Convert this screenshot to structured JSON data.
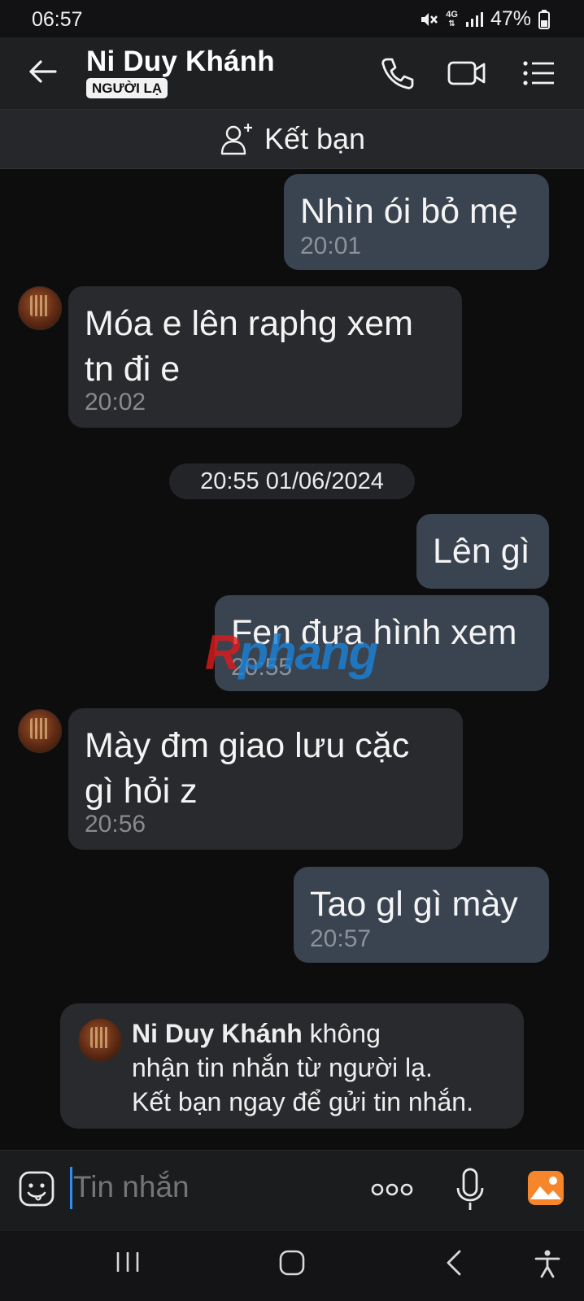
{
  "status_bar": {
    "time": "06:57",
    "network": "4G",
    "battery": "47%",
    "icons": [
      "mute-icon",
      "signal-icon",
      "battery-icon"
    ]
  },
  "header": {
    "contact_name": "Ni Duy Khánh",
    "badge": "NGƯỜI LẠ",
    "icons": [
      "back-arrow-icon",
      "phone-icon",
      "video-call-icon",
      "menu-list-icon"
    ]
  },
  "friend_bar": {
    "label": "Kết bạn",
    "icon": "add-person-icon"
  },
  "messages": [
    {
      "direction": "out",
      "text": "Nhìn ói bỏ mẹ",
      "time": "20:01"
    },
    {
      "direction": "in",
      "text": "Móa e lên raphg xem\ntn đi e",
      "time": "20:02"
    },
    {
      "direction": "out",
      "text": "Lên gì",
      "time": ""
    },
    {
      "direction": "out",
      "text": "Fen đưa hình xem",
      "time": "20:55"
    },
    {
      "direction": "in",
      "text": "Mày đm giao lưu cặc\ngì hỏi z",
      "time": "20:56"
    },
    {
      "direction": "out",
      "text": "Tao gl gì mày",
      "time": "20:57"
    }
  ],
  "date_separator": "20:55 01/06/2024",
  "watermark": {
    "first_letter": "R",
    "rest": "phang"
  },
  "notice": {
    "name": "Ni Duy Khánh",
    "line1_suffix": " không",
    "line2": "nhận tin nhắn từ người lạ.",
    "line3": "Kết bạn ngay để gửi tin nhắn."
  },
  "input_bar": {
    "placeholder": "Tin nhắn",
    "icons": [
      "sticker-icon",
      "more-options-icon",
      "microphone-icon",
      "gallery-icon"
    ]
  },
  "nav_bar": {
    "icons": [
      "recent-apps-icon",
      "home-icon",
      "back-icon",
      "accessibility-icon"
    ]
  },
  "colors": {
    "background": "#0d0d0e",
    "outgoing_bubble": "#3a4350",
    "incoming_bubble": "#292a2d",
    "accent": "#2f8cf5",
    "gallery_icon": "#f5862b"
  }
}
